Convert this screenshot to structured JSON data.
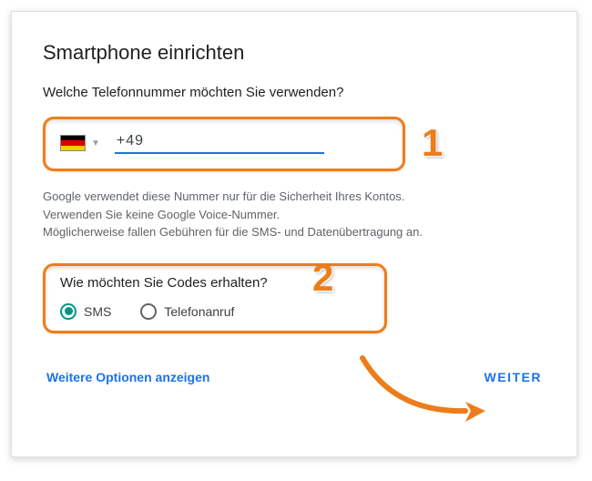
{
  "title": "Smartphone einrichten",
  "phoneQuestion": "Welche Telefonnummer möchten Sie verwenden?",
  "phonePrefix": "+49 ",
  "countryFlag": "germany-flag",
  "info": {
    "line1": "Google verwendet diese Nummer nur für die Sicherheit Ihres Kontos.",
    "line2": "Verwenden Sie keine Google Voice-Nummer.",
    "line3": "Möglicherweise fallen Gebühren für die SMS- und Datenübertragung an."
  },
  "codesQuestion": "Wie möchten Sie Codes erhalten?",
  "radios": {
    "sms": "SMS",
    "call": "Telefonanruf",
    "selected": "sms"
  },
  "moreOptions": "Weitere Optionen anzeigen",
  "next": "WEITER",
  "annotations": {
    "step1": "1",
    "step2": "2"
  }
}
